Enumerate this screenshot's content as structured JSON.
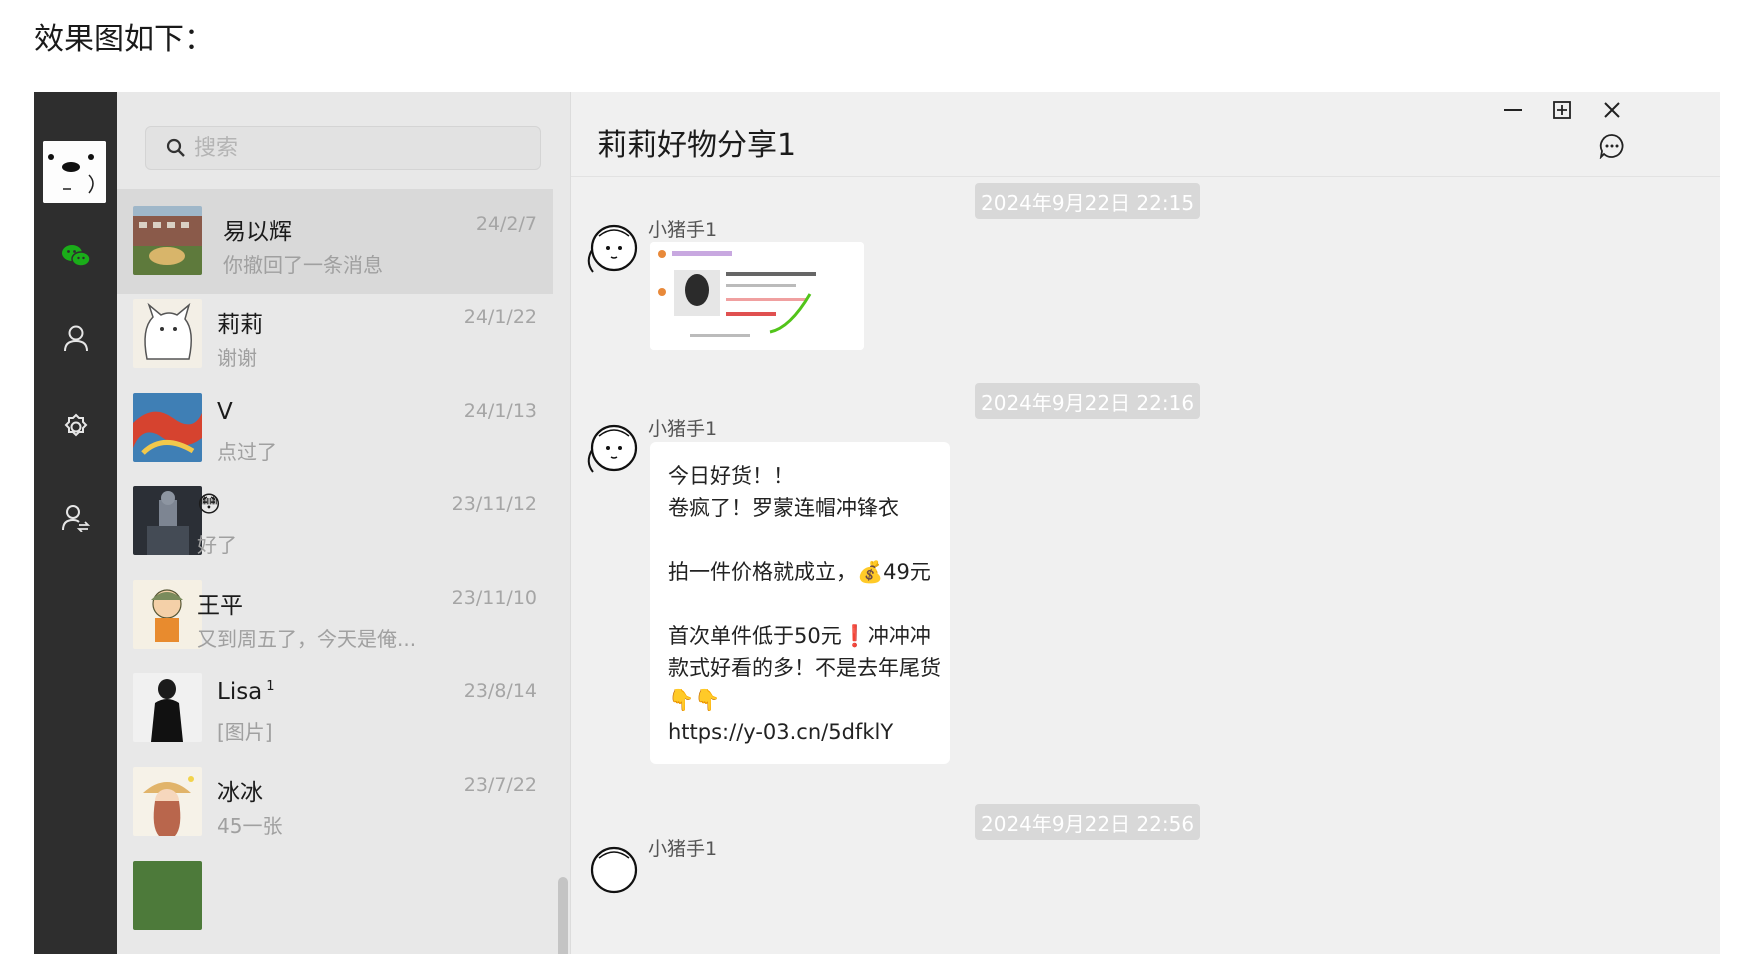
{
  "page_heading": "效果图如下：",
  "sidebar": {
    "icons": [
      "app-avatar-icon",
      "chat-icon",
      "contacts-icon",
      "settings-icon",
      "user-switch-icon"
    ],
    "accent_color": "#1aad19",
    "background_color": "#2e2e2e"
  },
  "search": {
    "placeholder": "搜索",
    "value": ""
  },
  "chats": [
    {
      "name": "易以辉",
      "time": "24/2/7",
      "preview": "你撤回了一条消息",
      "active": true
    },
    {
      "name": "莉莉",
      "time": "24/1/22",
      "preview": "谢谢"
    },
    {
      "name": "V",
      "time": "24/1/13",
      "preview": "点过了"
    },
    {
      "name": "😳",
      "time": "23/11/12",
      "preview": "好了"
    },
    {
      "name": "王平",
      "time": "23/11/10",
      "preview": "又到周五了，今天是俺..."
    },
    {
      "name": "Lisa",
      "badge": "1",
      "time": "23/8/14",
      "preview": "[图片]"
    },
    {
      "name": "冰冰",
      "time": "23/7/22",
      "preview": "45一张"
    }
  ],
  "conversation": {
    "title": "莉莉好物分享1",
    "window_controls": [
      "minimize-icon",
      "maximize-icon",
      "close-icon"
    ],
    "more_icon": "chat-more-icon",
    "messages": [
      {
        "timestamp": "2024年9月22日 22:15",
        "sender": "小猪手1",
        "type": "image"
      },
      {
        "timestamp": "2024年9月22日 22:16",
        "sender": "小猪手1",
        "type": "text",
        "lines": [
          "今日好货！！",
          "卷疯了！罗蒙连帽冲锋衣",
          "",
          "拍一件价格就成立，💰49元",
          "",
          "首次单件低于50元❗冲冲冲",
          "款式好看的多！不是去年尾货",
          "👇👇",
          "https://y-03.cn/5dfklY"
        ]
      },
      {
        "timestamp": "2024年9月22日 22:56",
        "sender": "小猪手1",
        "type": "partial"
      }
    ]
  }
}
